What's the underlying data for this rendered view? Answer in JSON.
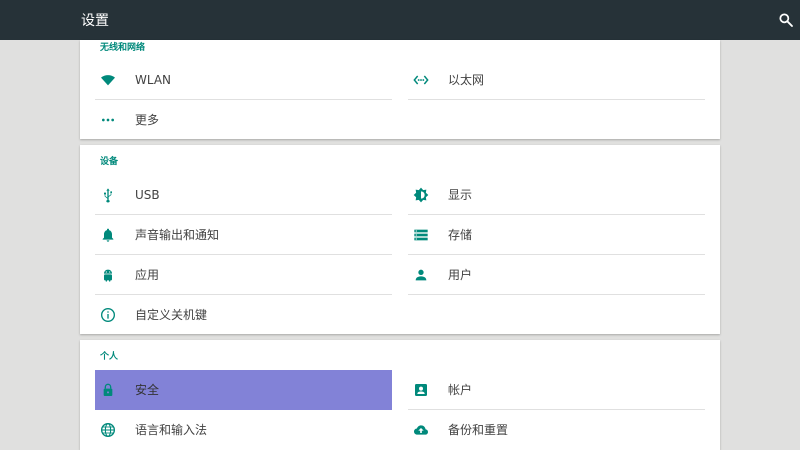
{
  "header": {
    "title": "设置",
    "search_icon": "search-icon"
  },
  "colors": {
    "header_bg": "#263238",
    "accent": "#00897b",
    "selected_bg": "#8282d7"
  },
  "sections": {
    "wireless": {
      "title": "无线和网络",
      "items": [
        {
          "label": "WLAN",
          "icon": "wifi-icon"
        },
        {
          "label": "以太网",
          "icon": "ethernet-icon"
        },
        {
          "label": "更多",
          "icon": "more-icon"
        }
      ]
    },
    "device": {
      "title": "设备",
      "items": [
        {
          "label": "USB",
          "icon": "usb-icon"
        },
        {
          "label": "显示",
          "icon": "brightness-icon"
        },
        {
          "label": "声音输出和通知",
          "icon": "bell-icon"
        },
        {
          "label": "存储",
          "icon": "storage-icon"
        },
        {
          "label": "应用",
          "icon": "android-icon"
        },
        {
          "label": "用户",
          "icon": "person-icon"
        },
        {
          "label": "自定义关机键",
          "icon": "info-icon"
        }
      ]
    },
    "personal": {
      "title": "个人",
      "items": [
        {
          "label": "安全",
          "icon": "lock-icon",
          "selected": true
        },
        {
          "label": "帐户",
          "icon": "account-box-icon"
        },
        {
          "label": "语言和输入法",
          "icon": "globe-icon"
        },
        {
          "label": "备份和重置",
          "icon": "cloud-upload-icon"
        }
      ]
    }
  }
}
